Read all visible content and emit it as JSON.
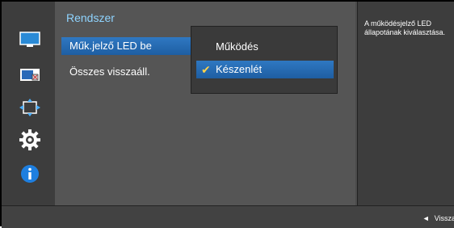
{
  "sidebar": {
    "items": [
      {
        "icon": "picture-icon"
      },
      {
        "icon": "pip-icon"
      },
      {
        "icon": "resize-icon"
      },
      {
        "icon": "settings-icon"
      },
      {
        "icon": "info-icon"
      }
    ]
  },
  "main": {
    "title": "Rendszer",
    "items": [
      {
        "label": "Műk.jelző LED be"
      },
      {
        "label": "Összes visszaáll."
      }
    ]
  },
  "submenu": {
    "options": [
      {
        "label": "Működés"
      },
      {
        "label": "Készenlét"
      }
    ],
    "check_symbol": "✔"
  },
  "help": {
    "text": "A működésjelző LED állapotának kiválasztása."
  },
  "bottom": {
    "back_label": "Vissza",
    "back_symbol": "◄"
  },
  "colors": {
    "accent": "#2f78c2",
    "title": "#8fd4ff",
    "check": "#ffd24a"
  }
}
